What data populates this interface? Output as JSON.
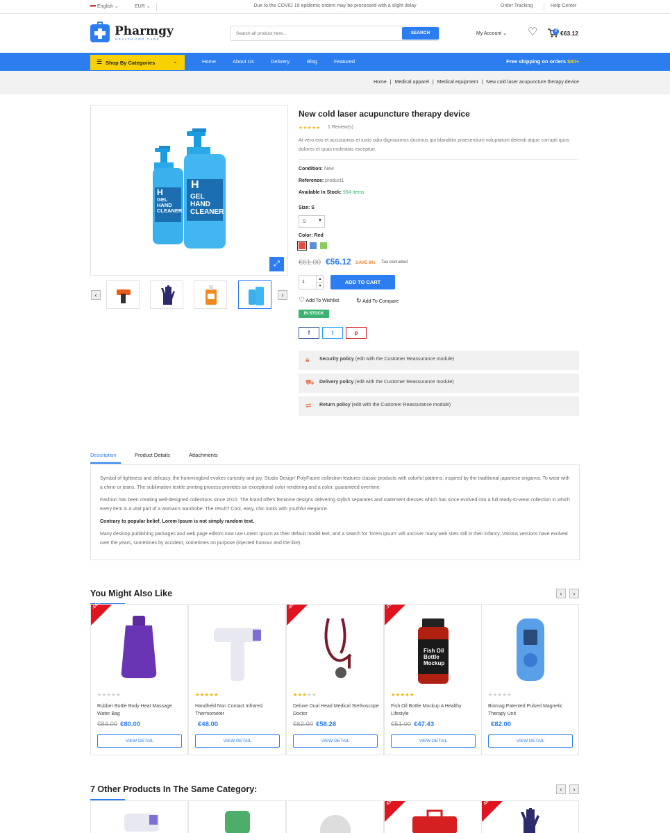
{
  "topbar": {
    "language": "English",
    "currency": "EUR",
    "notice": "Due to the COVID 19 epidemic orders may be processed with a slight delay",
    "order_tracking": "Order Tracking",
    "help_center": "Help Center"
  },
  "header": {
    "logo_name": "Pharmgy",
    "logo_tagline": "HEALTH AND CARE",
    "search_placeholder": "Search all product here...",
    "search_button": "SEARCH",
    "account": "My Account",
    "cart_count": "0",
    "cart_total": "€63.12"
  },
  "nav": {
    "categories_label": "Shop By Categories",
    "items": [
      "Home",
      "About Us",
      "Delivery",
      "Blog",
      "Featured"
    ],
    "shipping_prefix": "Free shipping on orders ",
    "shipping_amount": "$80+"
  },
  "breadcrumb": {
    "items": [
      "Home",
      "Medical apparel",
      "Medical equipment",
      "New cold laser acupuncture therapy device"
    ],
    "separator": "|"
  },
  "product": {
    "title": "New cold laser acupuncture therapy device",
    "stars": "★★★★★",
    "reviews": "1 Review(s)",
    "short_desc": "At vero eos et accusamus et iusto odio dignissimos ducimus qui blanditiis praesentium voluptatum deleniti atque corrupti quos dolores et quas molestias excepturi.",
    "condition_label": "Condition:",
    "condition_value": "New",
    "reference_label": "Reference:",
    "reference_value": "product1",
    "stock_label": "Available In Stock:",
    "stock_value": "994 Items",
    "size_label": "Size: S",
    "size_value": "S",
    "color_label": "Color: Red",
    "colors": [
      "#e74c3c",
      "#5b8fd9",
      "#8ccc5e"
    ],
    "old_price": "€61.00",
    "price": "€56.12",
    "save": "SAVE 8%",
    "tax": "Tax excluded",
    "qty": "1",
    "add_to_cart": "ADD TO CART",
    "wishlist": "Add To Wishlist",
    "compare": "Add To Compare",
    "in_stock": "IN STOCK",
    "bottle_text": [
      "GEL",
      "HAND",
      "CLEANER"
    ],
    "bottle_letter": "H"
  },
  "share": {
    "facebook": "f",
    "twitter": "t",
    "pinterest": "p"
  },
  "policies": [
    {
      "bold": "Security policy",
      "rest": " (edit with the Customer Reassurance module)",
      "icon": "lock-icon"
    },
    {
      "bold": "Delivery policy",
      "rest": " (edit with the Customer Reassurance module)",
      "icon": "truck-icon"
    },
    {
      "bold": "Return policy",
      "rest": " (edit with the Customer Reassurance module)",
      "icon": "return-icon"
    }
  ],
  "tabs": [
    "Description",
    "Product Details",
    "Attachments"
  ],
  "description": {
    "p1": "Symbol of lightness and delicacy, the hummingbird evokes curiosity and joy. Studio Design' PolyFaune collection features classic products with colorful patterns, inspired by the traditional japanese origamis. To wear with a chino or jeans. The sublimation textile printing process provides an exceptional color rendering and a color, guaranteed overtime.",
    "p2": "Fashion has been creating well-designed collections since 2010. The brand offers feminine designs delivering stylish separates and statement dresses which has since evolved into a full ready-to-wear collection in which every item is a vital part of a woman's wardrobe. The result? Cool, easy, chic looks with youthful elegance.",
    "p3": "Contrary to popular belief, Lorem Ipsum is not simply random text.",
    "p4": "Many desktop publishing packages and web page editors now use Lorem Ipsum as their default model text, and a search for 'lorem ipsum' will uncover many web sites still in their infancy. Various versions have evolved over the years, sometimes by accident, sometimes on purpose (injected humour and the like)."
  },
  "related": {
    "title": "You Might Also Like",
    "view_detail": "VIEW DETAIL",
    "products": [
      {
        "badge": "-€4.00",
        "stars": "★★★★★",
        "rating": 0,
        "name": "Rubber Bottle Body Heat Massage Water Bag",
        "old": "€84.00",
        "price": "€80.00"
      },
      {
        "badge": "",
        "stars": "★★★★★",
        "rating": 5,
        "name": "Handheld Non Contact Infrared Thermometer",
        "old": "",
        "price": "€48.00"
      },
      {
        "badge": "-6%",
        "stars": "★★★★★",
        "rating": 3,
        "name": "Deluxe Dual Head Medical Stethoscope Doctor",
        "old": "€62.00",
        "price": "€58.28"
      },
      {
        "badge": "-7%",
        "stars": "★★★★★",
        "rating": 5,
        "name": "Fish Oil Bottle Mockup A Healthy Lifestyle",
        "old": "€51.00",
        "price": "€47.43",
        "label_lines": [
          "Fish Oil",
          "Bottle",
          "Mockup"
        ]
      },
      {
        "badge": "",
        "stars": "★★★★★",
        "rating": 0,
        "name": "Biomag Patented Pulsed Magnetic Therapy Unit",
        "old": "",
        "price": "€82.00"
      }
    ]
  },
  "same_category": {
    "title": "7 Other Products In The Same Category:",
    "badges": [
      "",
      "",
      "",
      "-€5.00",
      "-€5.00"
    ]
  },
  "colors": {
    "accent": "#2b7df0",
    "yellow": "#f9d100",
    "sale": "#e0131e",
    "green": "#3cb371"
  }
}
